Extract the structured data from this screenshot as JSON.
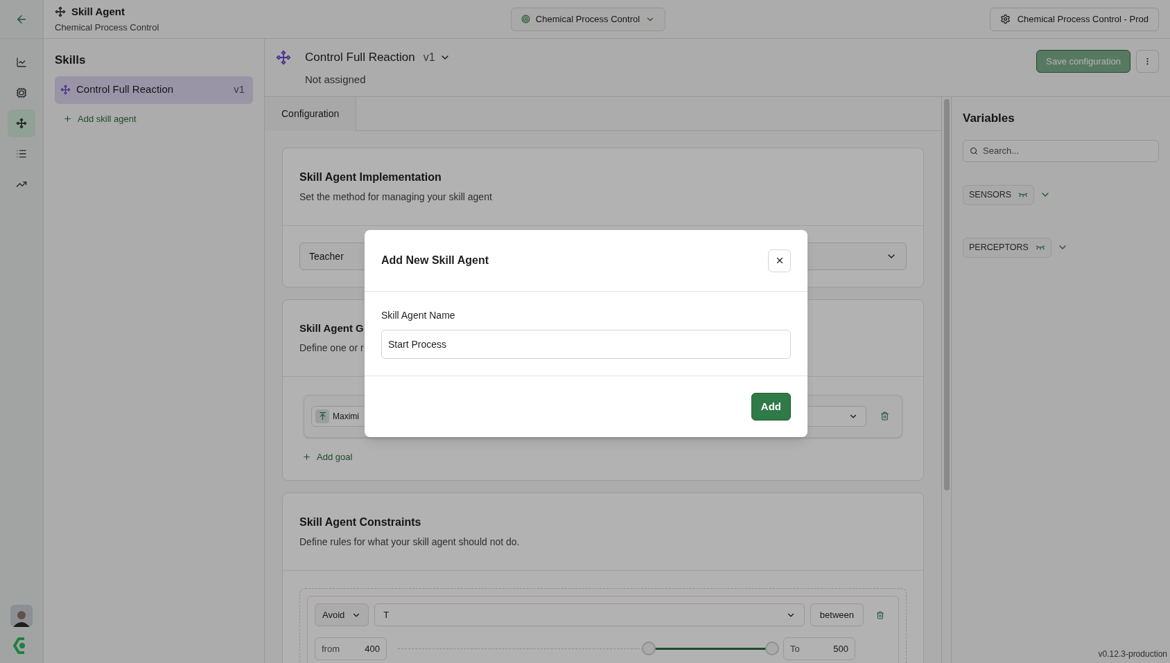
{
  "header": {
    "title": "Skill Agent",
    "subtitle": "Chemical Process Control",
    "project_select": "Chemical Process Control",
    "deployment_button": "Chemical Process Control - Prod"
  },
  "rail": [
    {
      "kind": "chart",
      "selected": false
    },
    {
      "kind": "chip",
      "selected": false
    },
    {
      "kind": "skill",
      "selected": true
    },
    {
      "kind": "list",
      "selected": false
    },
    {
      "kind": "trend",
      "selected": false
    }
  ],
  "skills": {
    "title": "Skills",
    "items": [
      {
        "name": "Control Full Reaction",
        "version": "v1",
        "selected": true
      }
    ],
    "add_link": "Add skill agent"
  },
  "skill_header": {
    "name": "Control Full Reaction",
    "version": "v1",
    "status": "Not assigned",
    "save_button": {
      "label": "Save configuration",
      "disabled": true
    }
  },
  "tabs": [
    {
      "label": "Configuration",
      "selected": true
    }
  ],
  "implementation": {
    "title": "Skill Agent Implementation",
    "description": "Set the method for managing your skill agent",
    "select_value": "Teacher"
  },
  "goals": {
    "title": "Skill Agent G",
    "description": "Define one or r",
    "goal_label": "Maximi",
    "add_link": "Add goal"
  },
  "constraints": {
    "title": "Skill Agent Constraints",
    "description": "Define rules for what your skill agent should not do.",
    "rows": [
      {
        "mode": "Avoid",
        "variable": "T",
        "operator": "between",
        "from_label": "from",
        "from_value": "400",
        "to_label": "To",
        "to_value": "500",
        "thumbs": [
          {
            "level": 0.67
          },
          {
            "level": 1
          }
        ]
      }
    ]
  },
  "variables": {
    "title": "Variables",
    "search_placeholder": "Search...",
    "groups": [
      {
        "label": "SENSORS"
      },
      {
        "label": "PERCEPTORS"
      }
    ]
  },
  "version": "v0.12.3-production",
  "dialog": {
    "title": "Add New Skill Agent",
    "field_label": "Skill Agent Name",
    "field_value": "Start Process",
    "submit": "Add"
  }
}
